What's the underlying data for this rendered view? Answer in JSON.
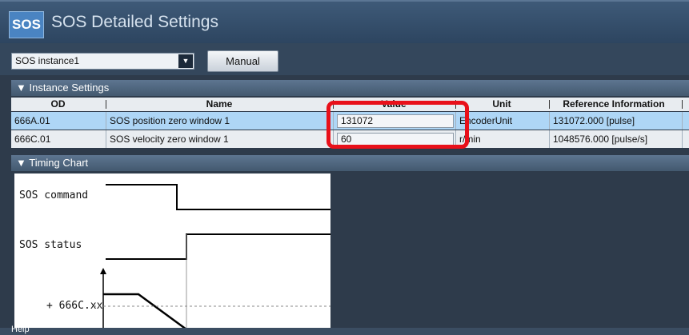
{
  "title": {
    "badge": "SOS",
    "text": "SOS Detailed Settings"
  },
  "toolbar": {
    "instance_select_value": "SOS instance1",
    "manual_label": "Manual"
  },
  "instance_settings": {
    "header": "▼ Instance Settings",
    "columns": [
      "OD",
      "Name",
      "Value",
      "Unit",
      "Reference Information"
    ],
    "rows": [
      {
        "od": "666A.01",
        "name": "SOS position zero window 1",
        "value": "131072",
        "unit": "EncoderUnit",
        "reference": "131072.000 [pulse]"
      },
      {
        "od": "666C.01",
        "name": "SOS velocity zero window 1",
        "value": "60",
        "unit": "r/min",
        "reference": "1048576.000 [pulse/s]"
      }
    ]
  },
  "timing_chart": {
    "header": "▼ Timing Chart",
    "labels": {
      "command": "SOS command",
      "status": "SOS status",
      "threshold": "+ 666C.xx"
    }
  },
  "help": {
    "header": "Help"
  },
  "colors": {
    "highlight": "#e8101a",
    "selected_row": "#aed6f6",
    "section_header": "#4b637c"
  }
}
